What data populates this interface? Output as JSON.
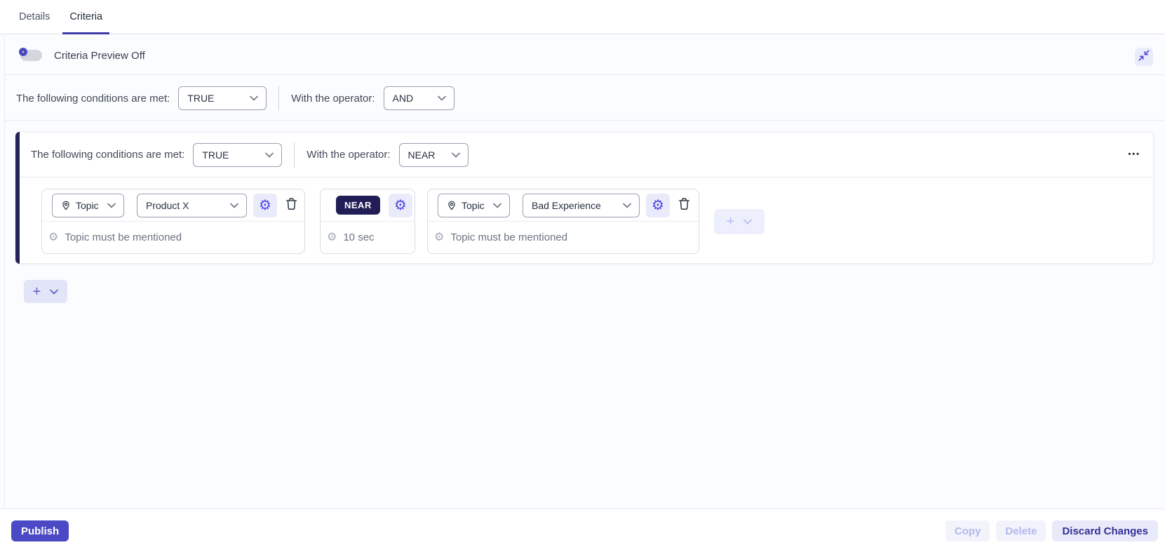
{
  "tabs": [
    {
      "label": "Details",
      "active": false
    },
    {
      "label": "Criteria",
      "active": true
    }
  ],
  "preview_toggle": {
    "label": "Criteria Preview Off",
    "state": "off"
  },
  "root_condition": {
    "conditions_label": "The following conditions are met:",
    "conditions_value": "TRUE",
    "operator_label": "With the operator:",
    "operator_value": "AND"
  },
  "group": {
    "conditions_label": "The following conditions are met:",
    "conditions_value": "TRUE",
    "operator_label": "With the operator:",
    "operator_value": "NEAR",
    "cards": [
      {
        "type": "Topic",
        "value": "Product X",
        "note": "Topic must be mentioned"
      },
      {
        "badge": "NEAR",
        "note": "10 sec"
      },
      {
        "type": "Topic",
        "value": "Bad Experience",
        "note": "Topic must be mentioned"
      }
    ]
  },
  "footer": {
    "publish": "Publish",
    "copy": "Copy",
    "delete": "Delete",
    "discard": "Discard Changes"
  },
  "icons": {
    "gear": "⚙",
    "plus": "+",
    "ellipsis": "•••"
  },
  "colors": {
    "accent_indigo": "#4b49c5",
    "dark_navy": "#252259",
    "light_lavender": "#e9ebfa",
    "panel_bg": "#fbfcfe",
    "muted_text": "#6b7280",
    "disabled_text": "#b2b8ee"
  }
}
